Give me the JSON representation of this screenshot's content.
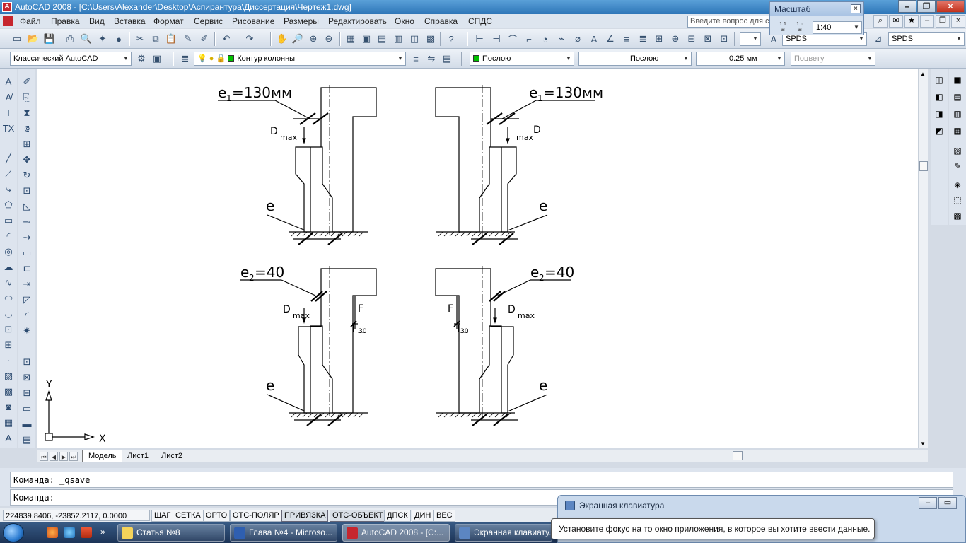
{
  "window": {
    "title": "AutoCAD 2008 - [C:\\Users\\Alexander\\Desktop\\Аспирантура\\Диссертация\\Чертеж1.dwg]",
    "app_icon": "autocad-logo-icon"
  },
  "menu": {
    "items": [
      "Файл",
      "Правка",
      "Вид",
      "Вставка",
      "Формат",
      "Сервис",
      "Рисование",
      "Размеры",
      "Редактировать",
      "Окно",
      "Справка",
      "СПДС"
    ],
    "help_placeholder": "Введите вопрос для с"
  },
  "toolbar": {
    "workspace": "Классический AutoCAD",
    "layer": "Контур колонны",
    "color": "Послою",
    "linetype": "Послою",
    "lineweight": "0.25 мм",
    "plotstyle": "Поцвету",
    "spds_style_1": "SPDS",
    "spds_style_2": "SPDS"
  },
  "scale_window": {
    "title": "Масштаб",
    "value": "1:40"
  },
  "drawing": {
    "label_e1": "e",
    "sub_1": "1",
    "value_e1": "=130мм",
    "label_e2": "e",
    "sub_2": "2",
    "value_e2": "=40",
    "label_e": "e",
    "label_D": "D",
    "label_max": "max",
    "label_F": "F",
    "label_30": "30",
    "ucs_x": "X",
    "ucs_y": "Y"
  },
  "layout_tabs": [
    "Модель",
    "Лист1",
    "Лист2"
  ],
  "command": {
    "line1": "Команда:  _qsave",
    "line2": "Команда:"
  },
  "status": {
    "coords": "224839.8406, -23852.2117, 0.0000",
    "buttons": [
      {
        "label": "ШАГ",
        "on": false
      },
      {
        "label": "СЕТКА",
        "on": false
      },
      {
        "label": "ОРТО",
        "on": false
      },
      {
        "label": "ОТС-ПОЛЯР",
        "on": false
      },
      {
        "label": "ПРИВЯЗКА",
        "on": true
      },
      {
        "label": "ОТС-ОБЪЕКТ",
        "on": true
      },
      {
        "label": "ДПСК",
        "on": false
      },
      {
        "label": "ДИН",
        "on": false
      },
      {
        "label": "ВЕС",
        "on": false
      }
    ]
  },
  "osk": {
    "title": "Экранная клавиатура",
    "tooltip": "Установите фокус на то окно приложения, в которое вы хотите ввести данные."
  },
  "taskbar": {
    "items": [
      "Статья №8",
      "Глава №4 - Microso...",
      "AutoCAD 2008 - [C:...",
      "Экранная клавиату..."
    ],
    "tray": [
      "lk",
      "brk"
    ]
  }
}
